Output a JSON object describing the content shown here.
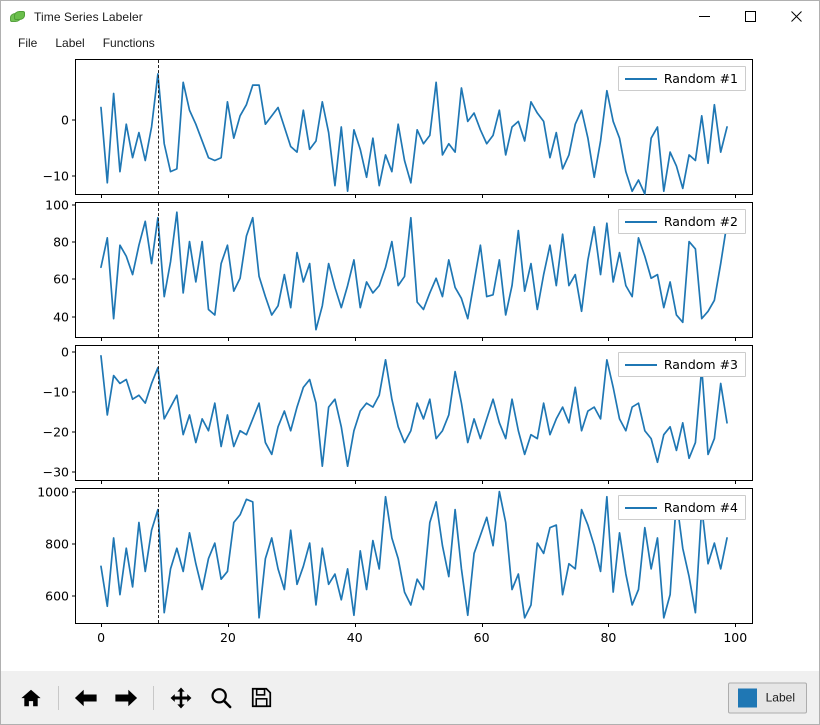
{
  "window": {
    "title": "Time Series Labeler",
    "icon": "leaf-icon",
    "controls": [
      {
        "name": "minimize-button",
        "glyph": "minimize"
      },
      {
        "name": "maximize-button",
        "glyph": "maximize"
      },
      {
        "name": "close-button",
        "glyph": "close"
      }
    ]
  },
  "menu": {
    "items": [
      {
        "label": "File"
      },
      {
        "label": "Label"
      },
      {
        "label": "Functions"
      }
    ]
  },
  "toolbar": {
    "buttons": [
      {
        "name": "home-button",
        "icon": "home-icon",
        "tooltip": "Home"
      },
      {
        "name": "back-button",
        "icon": "arrow-left-icon",
        "tooltip": "Back"
      },
      {
        "name": "forward-button",
        "icon": "arrow-right-icon",
        "tooltip": "Forward"
      },
      {
        "name": "pan-button",
        "icon": "move-icon",
        "tooltip": "Pan"
      },
      {
        "name": "zoom-button",
        "icon": "magnifier-icon",
        "tooltip": "Zoom"
      },
      {
        "name": "save-button",
        "icon": "floppy-disk-icon",
        "tooltip": "Save"
      }
    ],
    "label_button": {
      "text": "Label",
      "swatch_color": "#1f77b4"
    }
  },
  "colors": {
    "line": "#1f77b4",
    "marker_line": "#222222",
    "axes_border": "#000000",
    "toolbar_bg": "#f0f0f0"
  },
  "chart_data": [
    {
      "type": "line",
      "title": "",
      "legend": "Random #1",
      "legend_position": "upper right",
      "xlabel": "",
      "ylabel": "",
      "grid": false,
      "xlim": [
        -3.95,
        102.95
      ],
      "ylim": [
        -13.5,
        10.5
      ],
      "yticks": [
        0,
        -10
      ],
      "xticks": [
        0,
        20,
        40,
        60,
        80,
        100
      ],
      "x_tick_labels_visible": false,
      "marker_line_x": 9,
      "color": "#1f77b4",
      "x": [
        0,
        1,
        2,
        3,
        4,
        5,
        6,
        7,
        8,
        9,
        10,
        11,
        12,
        13,
        14,
        15,
        16,
        17,
        18,
        19,
        20,
        21,
        22,
        23,
        24,
        25,
        26,
        27,
        28,
        29,
        30,
        31,
        32,
        33,
        34,
        35,
        36,
        37,
        38,
        39,
        40,
        41,
        42,
        43,
        44,
        45,
        46,
        47,
        48,
        49,
        50,
        51,
        52,
        53,
        54,
        55,
        56,
        57,
        58,
        59,
        60,
        61,
        62,
        63,
        64,
        65,
        66,
        67,
        68,
        69,
        70,
        71,
        72,
        73,
        74,
        75,
        76,
        77,
        78,
        79,
        80,
        81,
        82,
        83,
        84,
        85,
        86,
        87,
        88,
        89,
        90,
        91,
        92,
        93,
        94,
        95,
        96,
        97,
        98,
        99
      ],
      "values": [
        2.0,
        -11.5,
        4.5,
        -9.5,
        -1.0,
        -7.0,
        -2.5,
        -7.5,
        -1.5,
        8.0,
        -4.5,
        -9.5,
        -9.0,
        6.5,
        1.5,
        -1.0,
        -4.0,
        -7.0,
        -7.5,
        -7.0,
        3.0,
        -3.5,
        0.5,
        2.5,
        6.0,
        6.0,
        -1.0,
        0.5,
        2.0,
        -1.5,
        -5.0,
        -6.0,
        1.5,
        -5.5,
        -4.0,
        3.0,
        -2.5,
        -12.0,
        -1.5,
        -13.0,
        -2.0,
        -5.5,
        -10.5,
        -3.5,
        -12.0,
        -6.5,
        -9.5,
        -1.0,
        -7.5,
        -11.5,
        -2.0,
        -4.5,
        -3.0,
        6.5,
        -6.5,
        -4.5,
        -6.0,
        5.5,
        -0.5,
        1.0,
        -2.0,
        -4.5,
        -3.0,
        1.5,
        -6.5,
        -1.5,
        -0.5,
        -4.0,
        3.0,
        1.0,
        -0.5,
        -7.0,
        -2.5,
        -9.0,
        -6.5,
        -1.0,
        1.5,
        -3.5,
        -10.5,
        -4.0,
        5.0,
        -0.5,
        -3.5,
        -9.5,
        -13.0,
        -11.0,
        -13.5,
        -3.5,
        -1.5,
        -13.0,
        -6.0,
        -8.5,
        -12.5,
        -6.5,
        -7.5,
        0.5,
        -8.0,
        2.5,
        -6.0,
        -1.5
      ]
    },
    {
      "type": "line",
      "title": "",
      "legend": "Random #2",
      "legend_position": "upper right",
      "xlabel": "",
      "ylabel": "",
      "grid": false,
      "xlim": [
        -3.95,
        102.95
      ],
      "ylim": [
        28,
        101
      ],
      "yticks": [
        100,
        80,
        60,
        40
      ],
      "xticks": [
        0,
        20,
        40,
        60,
        80,
        100
      ],
      "x_tick_labels_visible": false,
      "marker_line_x": 9,
      "color": "#1f77b4",
      "x": [
        0,
        1,
        2,
        3,
        4,
        5,
        6,
        7,
        8,
        9,
        10,
        11,
        12,
        13,
        14,
        15,
        16,
        17,
        18,
        19,
        20,
        21,
        22,
        23,
        24,
        25,
        26,
        27,
        28,
        29,
        30,
        31,
        32,
        33,
        34,
        35,
        36,
        37,
        38,
        39,
        40,
        41,
        42,
        43,
        44,
        45,
        46,
        47,
        48,
        49,
        50,
        51,
        52,
        53,
        54,
        55,
        56,
        57,
        58,
        59,
        60,
        61,
        62,
        63,
        64,
        65,
        66,
        67,
        68,
        69,
        70,
        71,
        72,
        73,
        74,
        75,
        76,
        77,
        78,
        79,
        80,
        81,
        82,
        83,
        84,
        85,
        86,
        87,
        88,
        89,
        90,
        91,
        92,
        93,
        94,
        95,
        96,
        97,
        98,
        99
      ],
      "values": [
        66,
        82,
        38,
        78,
        72,
        62,
        78,
        91,
        68,
        93,
        50,
        69,
        96,
        52,
        80,
        58,
        80,
        43,
        40,
        68,
        78,
        53,
        60,
        83,
        93,
        61,
        50,
        40,
        45,
        62,
        44,
        74,
        58,
        68,
        32,
        45,
        68,
        55,
        44,
        56,
        70,
        44,
        58,
        52,
        56,
        66,
        80,
        56,
        61,
        93,
        47,
        43,
        52,
        60,
        50,
        70,
        55,
        49,
        38,
        58,
        78,
        50,
        51,
        70,
        40,
        56,
        86,
        53,
        68,
        43,
        62,
        78,
        56,
        84,
        56,
        62,
        42,
        70,
        88,
        62,
        90,
        58,
        74,
        56,
        50,
        82,
        72,
        60,
        62,
        44,
        58,
        40,
        36,
        80,
        76,
        38,
        42,
        48,
        68,
        90
      ]
    },
    {
      "type": "line",
      "title": "",
      "legend": "Random #3",
      "legend_position": "upper right",
      "xlabel": "",
      "ylabel": "",
      "grid": false,
      "xlim": [
        -3.95,
        102.95
      ],
      "ylim": [
        -32.5,
        1.5
      ],
      "yticks": [
        0,
        -10,
        -20,
        -30
      ],
      "xticks": [
        0,
        20,
        40,
        60,
        80,
        100
      ],
      "x_tick_labels_visible": false,
      "marker_line_x": 9,
      "color": "#1f77b4",
      "x": [
        0,
        1,
        2,
        3,
        4,
        5,
        6,
        7,
        8,
        9,
        10,
        11,
        12,
        13,
        14,
        15,
        16,
        17,
        18,
        19,
        20,
        21,
        22,
        23,
        24,
        25,
        26,
        27,
        28,
        29,
        30,
        31,
        32,
        33,
        34,
        35,
        36,
        37,
        38,
        39,
        40,
        41,
        42,
        43,
        44,
        45,
        46,
        47,
        48,
        49,
        50,
        51,
        52,
        53,
        54,
        55,
        56,
        57,
        58,
        59,
        60,
        61,
        62,
        63,
        64,
        65,
        66,
        67,
        68,
        69,
        70,
        71,
        72,
        73,
        74,
        75,
        76,
        77,
        78,
        79,
        80,
        81,
        82,
        83,
        84,
        85,
        86,
        87,
        88,
        89,
        90,
        91,
        92,
        93,
        94,
        95,
        96,
        97,
        98,
        99
      ],
      "values": [
        -1,
        -16,
        -6,
        -8,
        -7,
        -12,
        -11,
        -13,
        -8,
        -4,
        -17,
        -14,
        -11,
        -21,
        -16,
        -23,
        -17,
        -20,
        -13,
        -24,
        -16,
        -24,
        -20,
        -21,
        -17,
        -13,
        -23,
        -26,
        -19,
        -15,
        -20,
        -14,
        -9,
        -7,
        -13,
        -29,
        -14,
        -12,
        -19,
        -29,
        -20,
        -15,
        -13,
        -14,
        -11,
        -2,
        -12,
        -19,
        -23,
        -20,
        -13,
        -17,
        -12,
        -22,
        -20,
        -16,
        -5,
        -13,
        -23,
        -17,
        -22,
        -17,
        -12,
        -18,
        -22,
        -12,
        -20,
        -26,
        -21,
        -22,
        -13,
        -21,
        -17,
        -14,
        -18,
        -9,
        -20,
        -15,
        -14,
        -17,
        -2,
        -9,
        -17,
        -20,
        -14,
        -13,
        -20,
        -22,
        -28,
        -21,
        -19,
        -25,
        -18,
        -27,
        -23,
        -4,
        -26,
        -22,
        -8,
        -18
      ]
    },
    {
      "type": "line",
      "title": "",
      "legend": "Random #4",
      "legend_position": "upper right",
      "xlabel": "",
      "ylabel": "",
      "grid": false,
      "xlim": [
        -3.95,
        102.95
      ],
      "ylim": [
        490,
        1010
      ],
      "yticks": [
        1000,
        800,
        600
      ],
      "xticks": [
        0,
        20,
        40,
        60,
        80,
        100
      ],
      "x_tick_labels_visible": true,
      "marker_line_x": 9,
      "color": "#1f77b4",
      "x": [
        0,
        1,
        2,
        3,
        4,
        5,
        6,
        7,
        8,
        9,
        10,
        11,
        12,
        13,
        14,
        15,
        16,
        17,
        18,
        19,
        20,
        21,
        22,
        23,
        24,
        25,
        26,
        27,
        28,
        29,
        30,
        31,
        32,
        33,
        34,
        35,
        36,
        37,
        38,
        39,
        40,
        41,
        42,
        43,
        44,
        45,
        46,
        47,
        48,
        49,
        50,
        51,
        52,
        53,
        54,
        55,
        56,
        57,
        58,
        59,
        60,
        61,
        62,
        63,
        64,
        65,
        66,
        67,
        68,
        69,
        70,
        71,
        72,
        73,
        74,
        75,
        76,
        77,
        78,
        79,
        80,
        81,
        82,
        83,
        84,
        85,
        86,
        87,
        88,
        89,
        90,
        91,
        92,
        93,
        94,
        95,
        96,
        97,
        98,
        99
      ],
      "values": [
        710,
        555,
        820,
        600,
        780,
        630,
        880,
        690,
        850,
        930,
        530,
        700,
        780,
        690,
        840,
        720,
        620,
        740,
        800,
        660,
        690,
        880,
        910,
        970,
        960,
        510,
        740,
        820,
        700,
        620,
        850,
        640,
        710,
        800,
        560,
        780,
        640,
        680,
        580,
        700,
        520,
        770,
        620,
        810,
        700,
        980,
        820,
        740,
        610,
        560,
        660,
        620,
        880,
        960,
        790,
        670,
        930,
        700,
        520,
        760,
        830,
        900,
        790,
        1000,
        880,
        620,
        680,
        510,
        560,
        800,
        760,
        860,
        870,
        600,
        720,
        700,
        930,
        870,
        790,
        690,
        980,
        610,
        840,
        680,
        560,
        620,
        860,
        700,
        820,
        510,
        600,
        970,
        780,
        670,
        530,
        940,
        720,
        800,
        700,
        820
      ]
    }
  ]
}
